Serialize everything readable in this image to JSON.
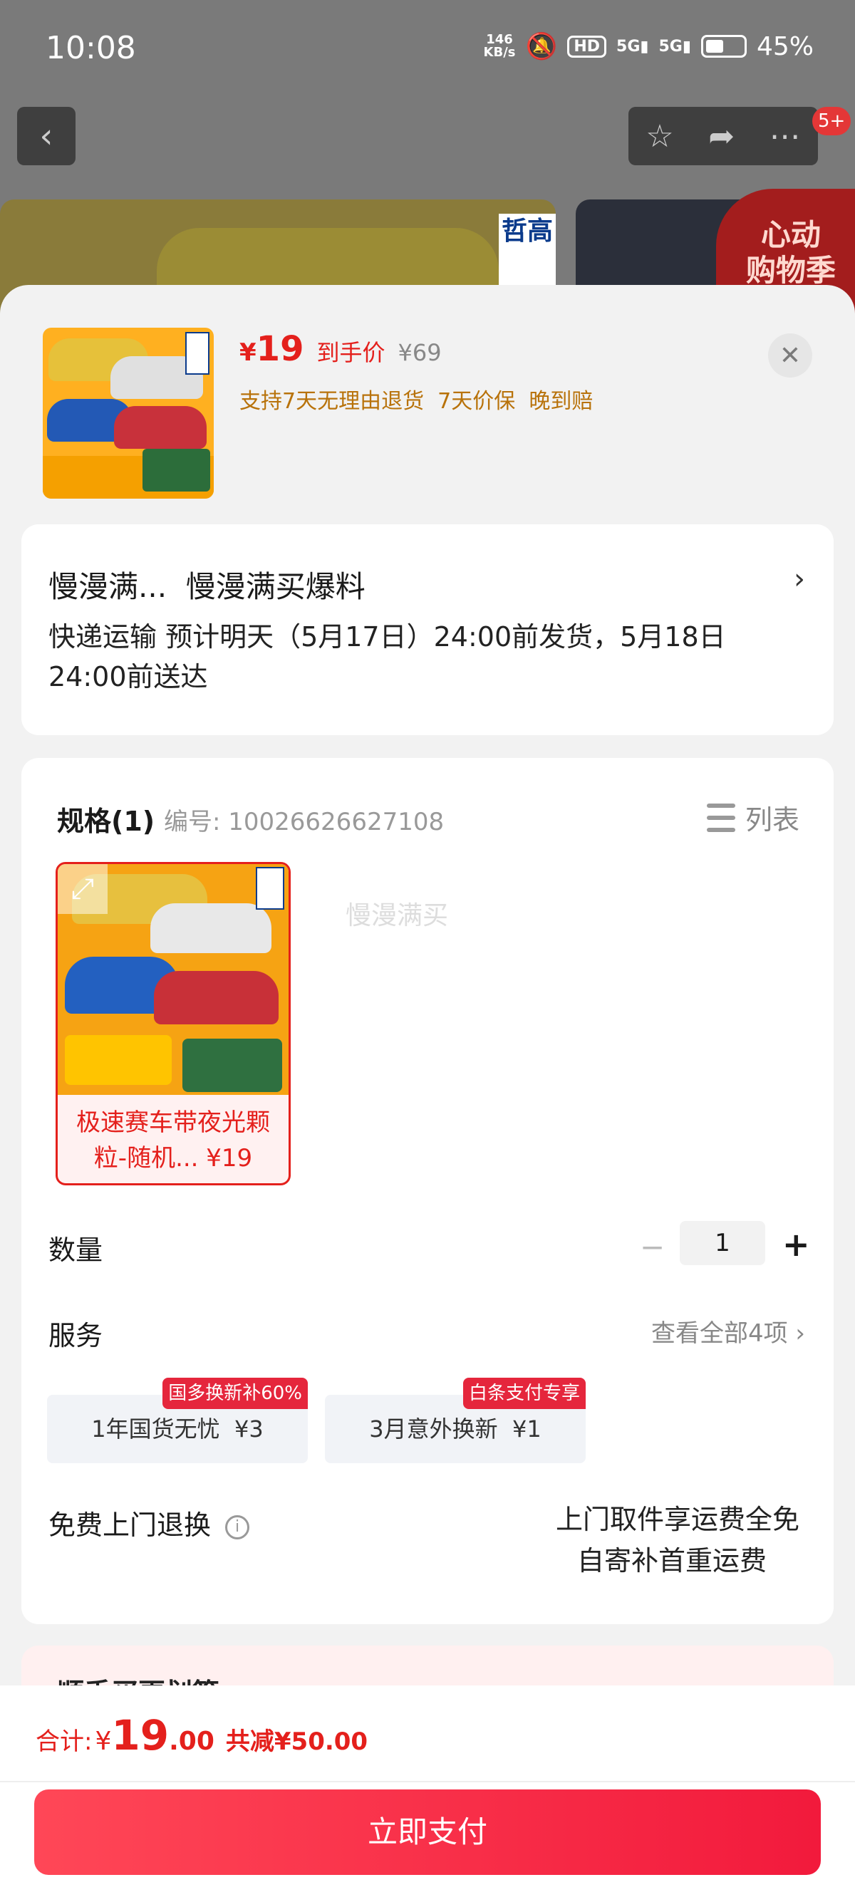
{
  "status_bar": {
    "time": "10:08",
    "net_speed_top": "146",
    "net_speed_bottom": "KB/s",
    "hd": "HD",
    "signal1": "5G",
    "signal2": "5G",
    "battery": "45%"
  },
  "top_bar": {
    "badge": "5+"
  },
  "background": {
    "brand": "哲高",
    "promo": "心动\n购物季"
  },
  "product": {
    "price_symbol": "¥",
    "price": "19",
    "price_label": "到手价",
    "original_price": "¥69",
    "guarantees": "支持7天无理由退货  7天价保  晚到赔"
  },
  "delivery": {
    "address": "慢漫满...  慢漫满买爆料",
    "text": "快递运输 预计明天（5月17日）24:00前发货，5月18日24:00前送达"
  },
  "spec": {
    "title": "规格(1)",
    "code": "编号: 10026626627108",
    "list_label": "列表",
    "watermark": "慢漫满买",
    "option_label": "极速赛车带夜光颗粒-随机... ¥19"
  },
  "quantity": {
    "label": "数量",
    "minus": "−",
    "value": "1",
    "plus": "+"
  },
  "service": {
    "label": "服务",
    "view_all": "查看全部4项 ›",
    "tiles": [
      {
        "text": "1年国货无忧  ¥3",
        "badge": "国多换新补60%"
      },
      {
        "text": "3月意外换新  ¥1",
        "badge": "白条支付专享"
      }
    ]
  },
  "return_service": {
    "label": "免费上门退换",
    "line1": "上门取件享运费全免",
    "line2": "自寄补首重运费"
  },
  "next_card": {
    "title": "顺手买更划算"
  },
  "footer": {
    "total_label": "合计:",
    "total_yen": "¥",
    "total_int": "19",
    "total_dec": ".00",
    "saved": "共减¥50.00",
    "pay_button": "立即支付"
  },
  "colors": {
    "accent": "#e4201c",
    "guarantee": "#b8720a"
  }
}
